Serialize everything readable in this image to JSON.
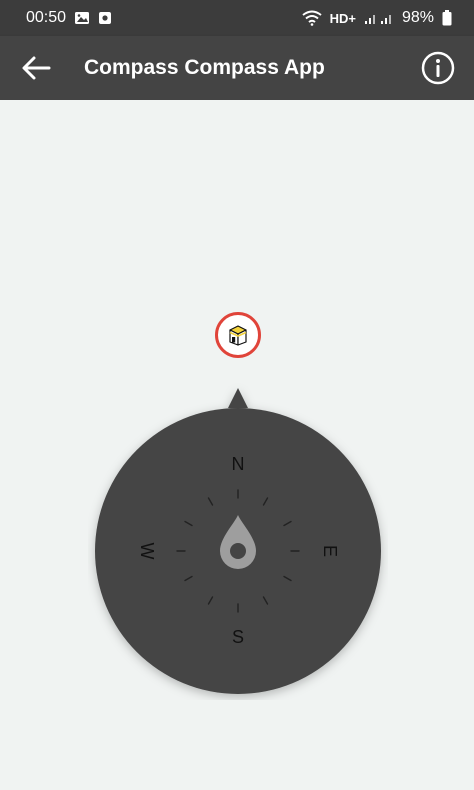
{
  "status_bar": {
    "time": "00:50",
    "battery": "98%",
    "network_badge": "HD+"
  },
  "app_bar": {
    "title": "Compass Compass App"
  },
  "compass": {
    "cardinals": {
      "north": "N",
      "south": "S",
      "east": "E",
      "west": "W"
    }
  },
  "colors": {
    "status_bar_bg": "#3c3c3c",
    "app_bar_bg": "#444444",
    "background": "#f0f3f2",
    "dial": "#444444",
    "needle": "#9e9e9e",
    "marker_ring": "#e0443a",
    "kaaba_gold": "#f2d23a"
  },
  "icons": [
    "gallery-icon",
    "screenshot-icon",
    "wifi-icon",
    "signal-icon",
    "battery-icon",
    "back-arrow-icon",
    "info-icon",
    "kaaba-icon",
    "compass-needle-icon"
  ]
}
